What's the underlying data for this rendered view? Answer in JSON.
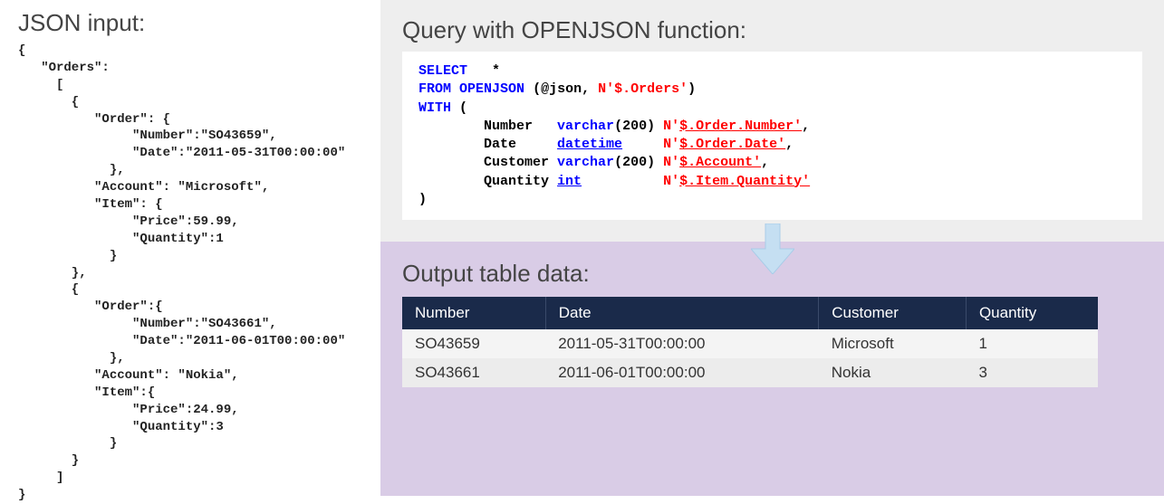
{
  "left": {
    "title": "JSON input:",
    "json_text": "{\n   \"Orders\":\n     [\n       {\n          \"Order\": {\n               \"Number\":\"SO43659\",\n               \"Date\":\"2011-05-31T00:00:00\"\n            },\n          \"Account\": \"Microsoft\",\n          \"Item\": {\n               \"Price\":59.99,\n               \"Quantity\":1\n            }\n       },\n       {\n          \"Order\":{\n               \"Number\":\"SO43661\",\n               \"Date\":\"2011-06-01T00:00:00\"\n            },\n          \"Account\": \"Nokia\",\n          \"Item\":{\n               \"Price\":24.99,\n               \"Quantity\":3\n            }\n       }\n     ]\n}"
  },
  "query": {
    "title": "Query with OPENJSON function:",
    "kw_select": "SELECT",
    "star": "*",
    "kw_from": "FROM",
    "fn_open": "OPENJSON",
    "paren_open": "(",
    "json_var": "@json",
    "comma": ",",
    "orders_path": "N'$.Orders'",
    "paren_close": ")",
    "kw_with": "WITH",
    "with_open": "(",
    "col1_name": "Number",
    "col1_type": "varchar",
    "col1_len": "200",
    "col1_path_prefix": "N'",
    "col1_path": "$.Order.Number'",
    "col2_name": "Date",
    "col2_type": "datetime",
    "col2_path_prefix": "N'",
    "col2_path": "$.Order.Date'",
    "col3_name": "Customer",
    "col3_type": "varchar",
    "col3_len": "200",
    "col3_path_prefix": "N'",
    "col3_path": "$.Account'",
    "col4_name": "Quantity",
    "col4_type": "int",
    "col4_path_prefix": "N'",
    "col4_path": "$.Item.Quantity'",
    "with_close": ")"
  },
  "output": {
    "title": "Output table data:",
    "headers": [
      "Number",
      "Date",
      "Customer",
      "Quantity"
    ],
    "rows": [
      [
        "SO43659",
        "2011-05-31T00:00:00",
        "Microsoft",
        "1"
      ],
      [
        "SO43661",
        "2011-06-01T00:00:00",
        "Nokia",
        "3"
      ]
    ]
  }
}
